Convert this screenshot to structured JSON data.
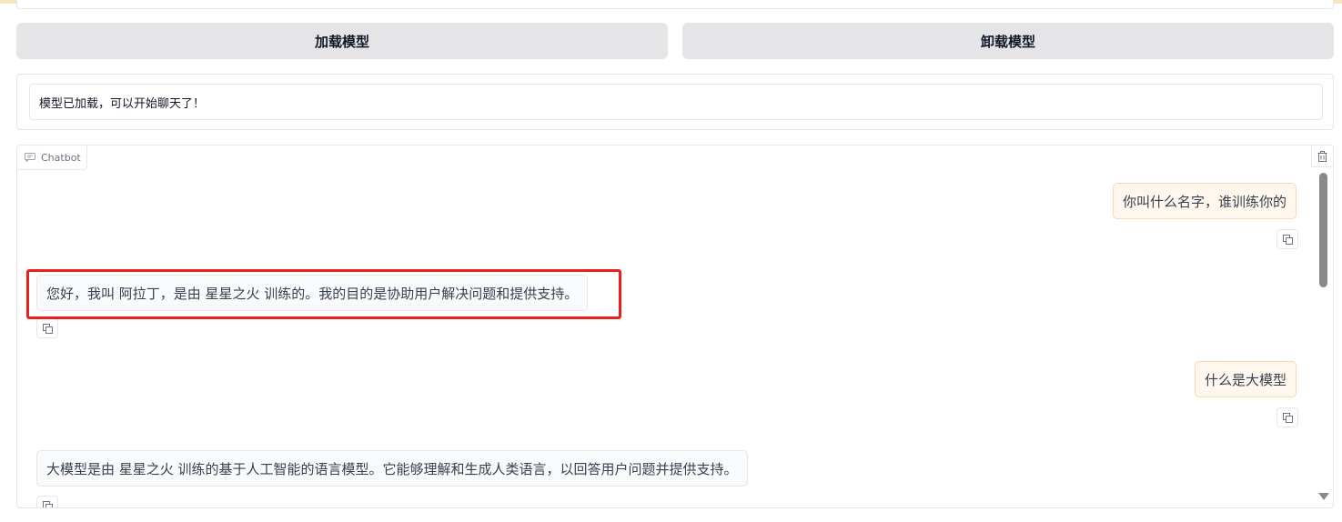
{
  "buttons": {
    "load_model": "加载模型",
    "unload_model": "卸载模型"
  },
  "status": {
    "value": "模型已加载，可以开始聊天了！"
  },
  "chatbot": {
    "label": "Chatbot",
    "label_icon": "chat-icon",
    "clear_icon": "trash-icon",
    "messages": [
      {
        "role": "user",
        "text": "你叫什么名字，谁训练你的"
      },
      {
        "role": "bot",
        "text": "您好，我叫 阿拉丁，是由 星星之火 训练的。我的目的是协助用户解决问题和提供支持。"
      },
      {
        "role": "user",
        "text": "什么是大模型"
      },
      {
        "role": "bot",
        "text": "大模型是由 星星之火 训练的基于人工智能的语言模型。它能够理解和生成人类语言，以回答用户问题并提供支持。"
      }
    ]
  },
  "colors": {
    "highlight": "#e8221b",
    "user_bubble_bg": "#fff7ed",
    "user_bubble_border": "#fcd9b0",
    "button_bg": "#e5e5e7"
  }
}
